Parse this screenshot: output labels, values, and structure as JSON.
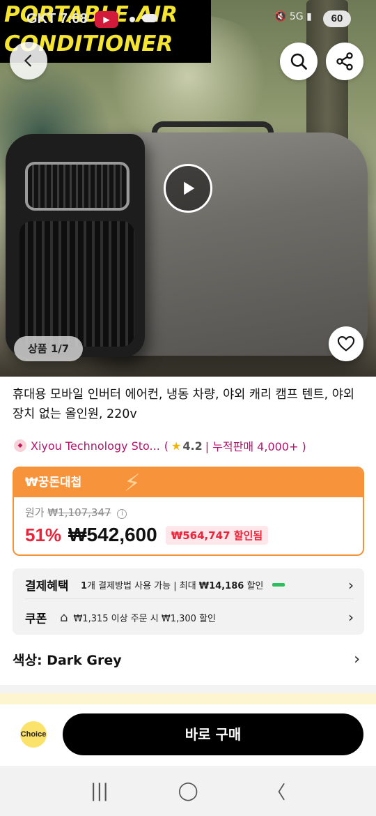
{
  "status_bar": {
    "time": "GKT 7:08",
    "youtube": "▶",
    "network": "5G",
    "battery": "60"
  },
  "hero": {
    "promo_line1": "PORTABLE AIR",
    "promo_line2": "CONDITIONER",
    "counter": "상품 1/7"
  },
  "product": {
    "title": "휴대용 모바일 인버터 에어컨, 냉동 차량, 야외 캐리 캠프 텐트, 야외 장치 없는 올인원, 220v"
  },
  "store": {
    "name": "Xiyou Technology Sto...",
    "rating": "4.2",
    "sales": "| 누적판매 4,000+ )",
    "open_paren": "("
  },
  "price": {
    "header": "₩꿍돈대첩",
    "original_label": "원가",
    "original_price": "₩1,107,347",
    "discount_pct": "51%",
    "current_price": "₩542,600",
    "saved": "₩564,747 할인됨"
  },
  "benefits": {
    "payment_label": "결제혜택",
    "payment_count": "1",
    "payment_text": "개 결제방법 사용 가능 | 최대",
    "payment_amount": "₩14,186",
    "payment_suffix": "할인",
    "coupon_label": "쿠폰",
    "coupon_text": "₩1,315 이상 주문 시 ₩1,300 할인"
  },
  "option": {
    "color_label": "색상: Dark Grey"
  },
  "bottom": {
    "choice": "Choice",
    "buy_now": "바로 구매"
  },
  "navbar": {
    "recent": "|||",
    "home": "◯",
    "back": "〈"
  }
}
